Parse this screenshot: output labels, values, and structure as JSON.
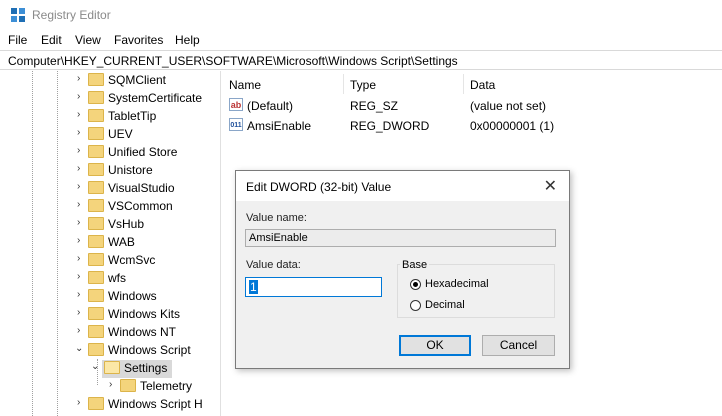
{
  "window": {
    "title": "Registry Editor"
  },
  "menu": [
    "File",
    "Edit",
    "View",
    "Favorites",
    "Help"
  ],
  "address": "Computer\\HKEY_CURRENT_USER\\SOFTWARE\\Microsoft\\Windows Script\\Settings",
  "tree": {
    "items": [
      {
        "label": "SQMClient"
      },
      {
        "label": "SystemCertificate"
      },
      {
        "label": "TabletTip"
      },
      {
        "label": "UEV"
      },
      {
        "label": "Unified Store"
      },
      {
        "label": "Unistore"
      },
      {
        "label": "VisualStudio"
      },
      {
        "label": "VSCommon"
      },
      {
        "label": "VsHub"
      },
      {
        "label": "WAB"
      },
      {
        "label": "WcmSvc"
      },
      {
        "label": "wfs"
      },
      {
        "label": "Windows"
      },
      {
        "label": "Windows Kits"
      },
      {
        "label": "Windows NT"
      },
      {
        "label": "Windows Script"
      },
      {
        "label": "Settings"
      },
      {
        "label": "Telemetry"
      },
      {
        "label": "Windows Script H"
      }
    ]
  },
  "list": {
    "headers": {
      "name": "Name",
      "type": "Type",
      "data": "Data"
    },
    "rows": [
      {
        "icon": "string-value-icon",
        "glyph": "ab",
        "name": "(Default)",
        "type": "REG_SZ",
        "data": "(value not set)"
      },
      {
        "icon": "binary-value-icon",
        "glyph": "011",
        "name": "AmsiEnable",
        "type": "REG_DWORD",
        "data": "0x00000001 (1)"
      }
    ]
  },
  "dialog": {
    "title": "Edit DWORD (32-bit) Value",
    "value_name_label": "Value name:",
    "value_name": "AmsiEnable",
    "value_data_label": "Value data:",
    "value_data": "1",
    "base_label": "Base",
    "hex_label": "Hexadecimal",
    "dec_label": "Decimal",
    "selected_base": "Hexadecimal",
    "ok_label": "OK",
    "cancel_label": "Cancel"
  }
}
